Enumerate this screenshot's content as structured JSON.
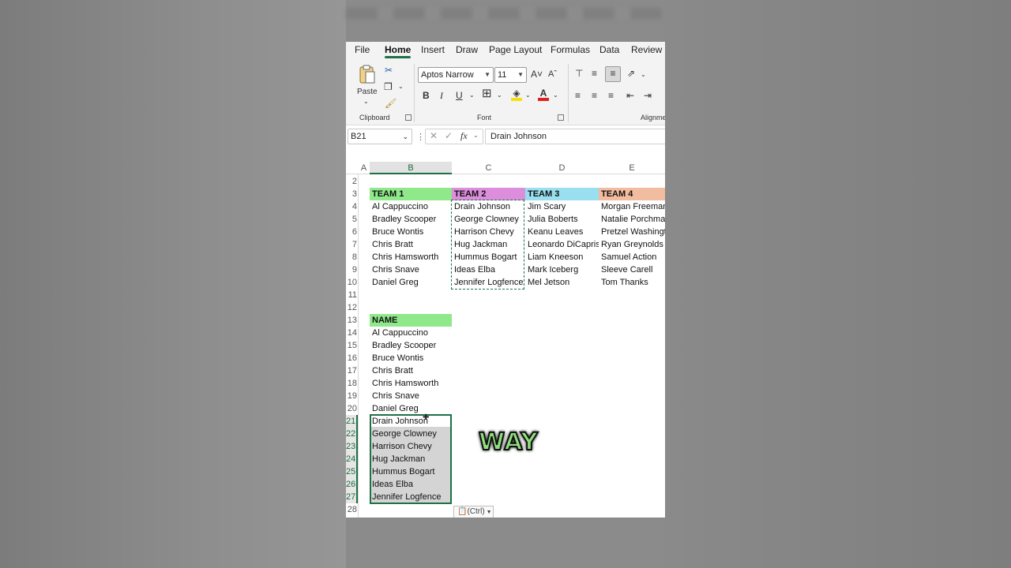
{
  "menu_tabs": [
    "File",
    "Home",
    "Insert",
    "Draw",
    "Page Layout",
    "Formulas",
    "Data",
    "Review"
  ],
  "active_tab": "Home",
  "ribbon": {
    "paste_label": "Paste",
    "clipboard_label": "Clipboard",
    "font_label": "Font",
    "alignment_label": "Alignme",
    "font_name": "Aptos Narrow",
    "font_size": "11",
    "bold": "B",
    "italic": "I",
    "underline": "U"
  },
  "formula_bar": {
    "name_box": "B21",
    "fx": "fx",
    "content": "Drain Johnson"
  },
  "columns": [
    "A",
    "B",
    "C",
    "D",
    "E"
  ],
  "rows": [
    "2",
    "3",
    "4",
    "5",
    "6",
    "7",
    "8",
    "9",
    "10",
    "11",
    "12",
    "13",
    "14",
    "15",
    "16",
    "17",
    "18",
    "19",
    "20",
    "21",
    "22",
    "23",
    "24",
    "25",
    "26",
    "27",
    "28"
  ],
  "teams": {
    "headers": [
      "TEAM 1",
      "TEAM 2",
      "TEAM 3",
      "TEAM 4"
    ],
    "header_colors": [
      "#8fe88a",
      "#dc8edc",
      "#99dff0",
      "#f2bca0"
    ],
    "team1": [
      "Al Cappuccino",
      "Bradley Scooper",
      "Bruce Wontis",
      "Chris Bratt",
      "Chris Hamsworth",
      "Chris Snave",
      "Daniel Greg"
    ],
    "team2": [
      "Drain Johnson",
      "George Clowney",
      "Harrison Chevy",
      "Hug Jackman",
      "Hummus Bogart",
      "Ideas Elba",
      "Jennifer Logfence"
    ],
    "team3": [
      "Jim Scary",
      "Julia Boberts",
      "Keanu Leaves",
      "Leonardo DiCaprisun",
      "Liam Kneeson",
      "Mark Iceberg",
      "Mel Jetson"
    ],
    "team4": [
      "Morgan Freeman",
      "Natalie Porchman",
      "Pretzel Washington",
      "Ryan Greynolds",
      "Samuel Action",
      "Sleeve Carell",
      "Tom Thanks"
    ]
  },
  "name_list": {
    "header": "NAME",
    "header_color": "#8fe88a",
    "items": [
      "Al Cappuccino",
      "Bradley Scooper",
      "Bruce Wontis",
      "Chris Bratt",
      "Chris Hamsworth",
      "Chris Snave",
      "Daniel Greg",
      "Drain Johnson",
      "George Clowney",
      "Harrison Chevy",
      "Hug Jackman",
      "Hummus Bogart",
      "Ideas Elba",
      "Jennifer Logfence"
    ]
  },
  "paste_options_label": "(Ctrl)",
  "overlay_word": "WAY",
  "accent_color": "#1e7145"
}
